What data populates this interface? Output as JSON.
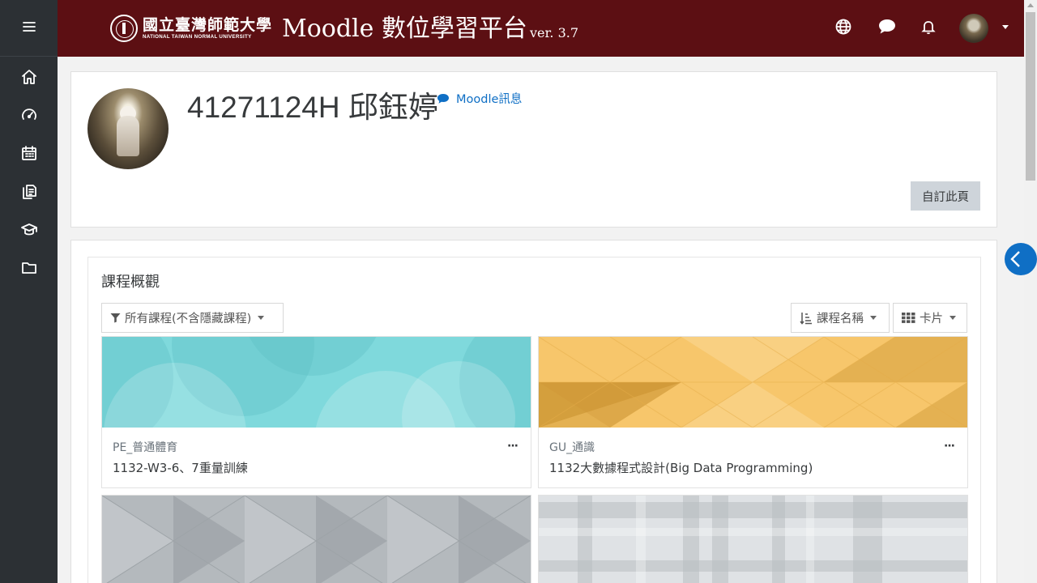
{
  "sidebar": {
    "items": [
      {
        "icon": "home-icon"
      },
      {
        "icon": "dashboard-icon"
      },
      {
        "icon": "calendar-icon"
      },
      {
        "icon": "files-icon"
      },
      {
        "icon": "mortarboard-icon"
      },
      {
        "icon": "folder-icon"
      }
    ]
  },
  "header": {
    "university_zh": "國立臺灣師範大學",
    "university_en": "NATIONAL TAIWAN NORMAL UNIVERSITY",
    "site_title": "Moodle 數位學習平台",
    "version": "ver. 3.7",
    "icons": [
      "globe-icon",
      "messages-icon",
      "notifications-icon"
    ]
  },
  "profile": {
    "name": "41271124H 邱鈺婷",
    "message_link": "Moodle訊息",
    "customize_button": "自訂此頁"
  },
  "overview": {
    "title": "課程概觀",
    "filter": "所有課程(不含隱藏課程)",
    "sort": "課程名稱",
    "view": "卡片"
  },
  "courses": [
    {
      "category": "PE_普通體育",
      "name": "1132-W3-6、7重量訓練",
      "more": "···",
      "pattern_color": "#7fd9dc"
    },
    {
      "category": "GU_通識",
      "name": "1132大數據程式設計(Big Data Programming)",
      "more": "···",
      "pattern_color": "#f7c66b"
    },
    {
      "category": "",
      "name": "",
      "more": "",
      "pattern_color": "#b4b9bd"
    },
    {
      "category": "",
      "name": "",
      "more": "",
      "pattern_color": "#dfe2e5"
    }
  ],
  "colors": {
    "navbar": "#5c0f13",
    "sidebar": "#2c3034",
    "link": "#0f6fc5"
  }
}
